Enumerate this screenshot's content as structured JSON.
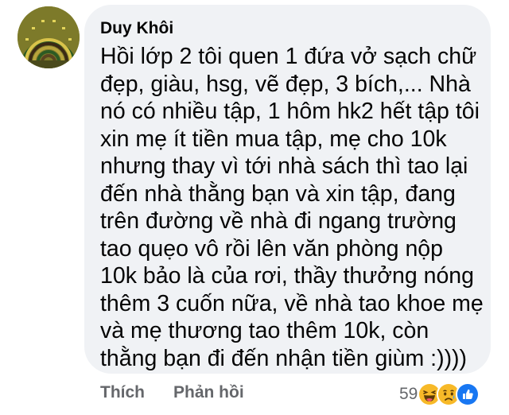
{
  "comment": {
    "author": "Duy Khôi",
    "lines": [
      "Hồi lớp 2 tôi quen 1 đứa vở sạch chữ",
      "đẹp, giàu, hsg, vẽ đẹp, 3 bích,... Nhà",
      "nó có nhiều tập, 1 hôm hk2 hết tập tôi",
      "xin mẹ ít tiền mua tập, mẹ cho 10k",
      "nhưng thay vì tới nhà sách thì tao lại",
      "đến nhà thằng bạn và xin tập, đang",
      "trên đường về nhà đi ngang trường",
      "tao quẹo vô rồi lên văn phòng nộp",
      "10k bảo là của rơi, thầy thưởng nóng",
      "thêm 3 cuốn nữa, về nhà tao khoe mẹ",
      "và mẹ thương tao thêm 10k, còn",
      "thằng bạn đi đến nhận tiền giùm :))))"
    ]
  },
  "actions": {
    "like_label": "Thích",
    "reply_label": "Phản hồi"
  },
  "reactions": {
    "count": "59",
    "icons": [
      "haha-icon",
      "sad-icon",
      "like-icon"
    ]
  },
  "colors": {
    "bubble": "#f0f2f5",
    "text": "#050505",
    "muted": "#65676b",
    "like_blue": "#1877f2",
    "emoji_yellow": "#f7b928"
  }
}
